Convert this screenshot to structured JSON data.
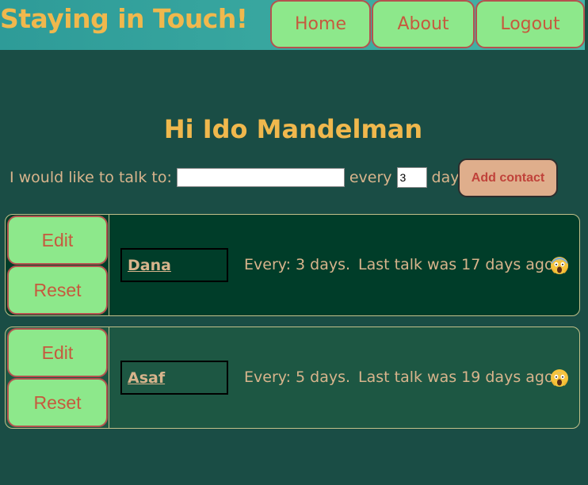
{
  "header": {
    "title": "Staying in Touch!",
    "nav": {
      "home": "Home",
      "about": "About",
      "logout": "Logout"
    }
  },
  "greeting": "Hi Ido Mandelman",
  "form": {
    "talk_label": "I would like to talk to:",
    "name_value": "",
    "every_label": "every",
    "days_value": "3",
    "days_label": "days",
    "add_button": "Add contact"
  },
  "contacts": [
    {
      "edit": "Edit",
      "reset": "Reset",
      "name": "Dana",
      "frequency": "Every: 3 days.",
      "last_talk": "Last talk was 17 days ago",
      "status_icon": "screaming-face-emoji"
    },
    {
      "edit": "Edit",
      "reset": "Reset",
      "name": "Asaf",
      "frequency": "Every: 5 days.",
      "last_talk": "Last talk was 19 days ago",
      "status_icon": "screaming-face-emoji"
    }
  ],
  "colors": {
    "background": "#1a4d45",
    "header_gradient_start": "#2e9b98",
    "title": "#f0b84d",
    "button_green": "#8de88b",
    "button_text": "#c65a3e",
    "add_button_bg": "#dfae8c",
    "card_1_bg": "#003d29",
    "card_2_bg": "#1d5743"
  }
}
